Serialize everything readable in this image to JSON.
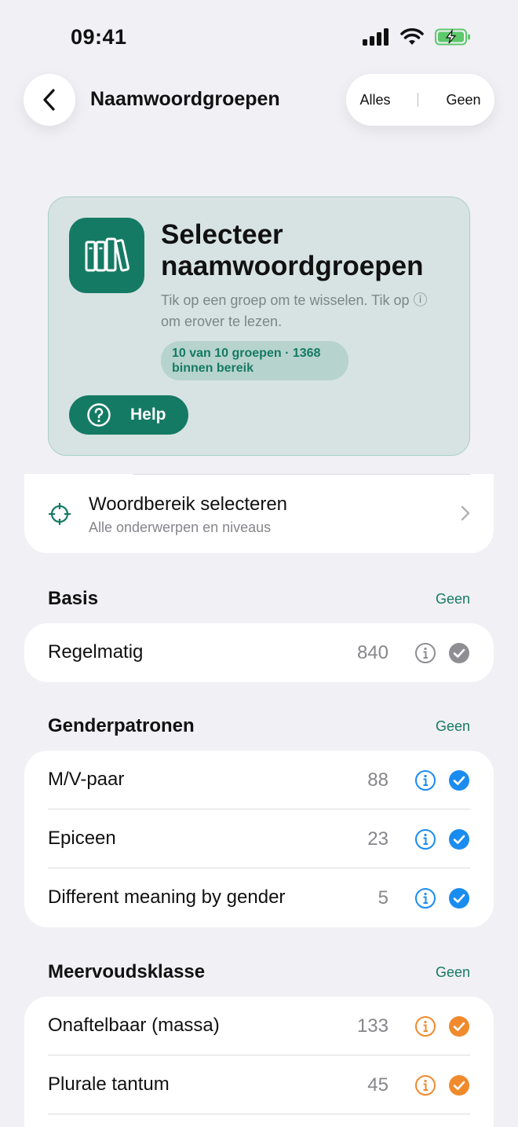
{
  "status": {
    "time": "09:41"
  },
  "nav": {
    "title": "Naamwoordgroepen",
    "all_label": "Alles",
    "none_label": "Geen"
  },
  "hero": {
    "title": "Selecteer naamwoordgroepen",
    "subtitle": "Tik op een groep om te wisselen. Tik op ⓘ om erover te lezen.",
    "badge": "10 van 10 groepen · 1368 binnen bereik",
    "help_label": "Help"
  },
  "range": {
    "title": "Woordbereik selecteren",
    "subtitle": "Alle onderwerpen en niveaus"
  },
  "colors": {
    "accent": "#157A64",
    "blue": "#1A8CF0",
    "orange": "#F08A2C",
    "gray": "#8E8E93"
  },
  "sections": [
    {
      "title": "Basis",
      "action": "Geen",
      "rows": [
        {
          "label": "Regelmatig",
          "count": "840"
        }
      ]
    },
    {
      "title": "Genderpatronen",
      "action": "Geen",
      "rows": [
        {
          "label": "M/V-paar",
          "count": "88"
        },
        {
          "label": "Epiceen",
          "count": "23"
        },
        {
          "label": "Different meaning by gender",
          "count": "5"
        }
      ]
    },
    {
      "title": "Meervoudsklasse",
      "action": "Geen",
      "rows": [
        {
          "label": "Onaftelbaar (massa)",
          "count": "133"
        },
        {
          "label": "Plurale tantum",
          "count": "45"
        }
      ]
    }
  ]
}
